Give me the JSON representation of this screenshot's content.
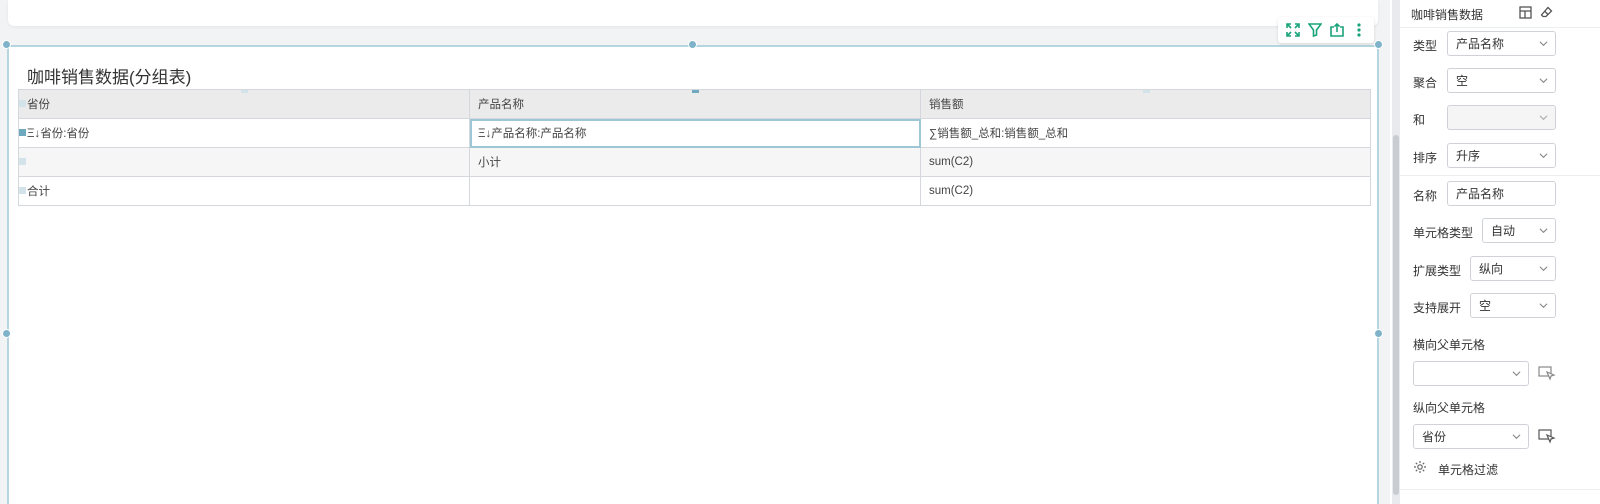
{
  "widget": {
    "title": "咖啡销售数据(分组表)",
    "table": {
      "headers": [
        "省份",
        "产品名称",
        "销售额"
      ],
      "rows": [
        [
          "Ξ↓省份:省份",
          "Ξ↓产品名称:产品名称",
          "∑销售额_总和:销售额_总和"
        ],
        [
          "",
          "小计",
          "sum(C2)"
        ],
        [
          "合计",
          "",
          "sum(C2)"
        ]
      ]
    }
  },
  "toolbar": {
    "icons": [
      "fullscreen-icon",
      "filter-icon",
      "export-icon",
      "more-icon"
    ],
    "accent": "#1aa37a"
  },
  "panel": {
    "title": "咖啡销售数据",
    "fields": {
      "type": {
        "label": "类型",
        "value": "产品名称"
      },
      "aggregate": {
        "label": "聚合",
        "value": "空"
      },
      "and": {
        "label": "和",
        "value": ""
      },
      "sort": {
        "label": "排序",
        "value": "升序"
      },
      "name": {
        "label": "名称",
        "value": "产品名称"
      },
      "cell_type": {
        "label": "单元格类型",
        "value": "自动"
      },
      "expand_type": {
        "label": "扩展类型",
        "value": "纵向"
      },
      "support_expand": {
        "label": "支持展开",
        "value": "空"
      },
      "h_parent": {
        "label": "横向父单元格",
        "value": ""
      },
      "v_parent": {
        "label": "纵向父单元格",
        "value": "省份"
      }
    },
    "cell_filter": "单元格过滤"
  },
  "colors": {
    "selection": "#9dc6d6",
    "handle": "#7fb3c9",
    "header_bg": "#ebebeb"
  }
}
